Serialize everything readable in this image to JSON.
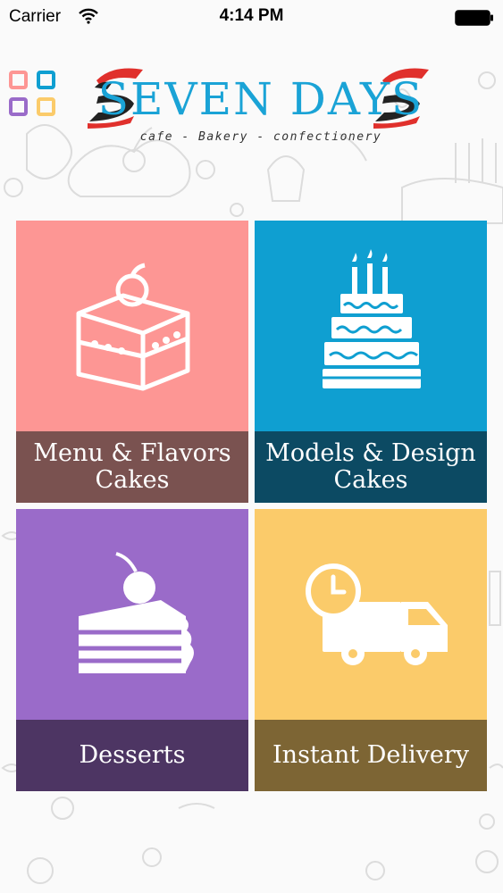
{
  "status_bar": {
    "carrier": "Carrier",
    "time": "4:14 PM"
  },
  "header": {
    "menu_icon": "grid-squares-icon",
    "logo_title": "SEVEN DAYS",
    "logo_tagline": "cafe - Bakery - confectionery"
  },
  "tiles": [
    {
      "label_line1": "Menu & Flavors",
      "label_line2": "Cakes",
      "icon": "cake-slice-with-cherry-icon",
      "color": "#fd9694",
      "label_bg": "#7a5250"
    },
    {
      "label_line1": "Models & Design",
      "label_line2": "Cakes",
      "icon": "tiered-birthday-cake-icon",
      "color": "#0f9fd1",
      "label_bg": "#0c4a63"
    },
    {
      "label_line1": "Desserts",
      "label_line2": "",
      "icon": "layer-cake-slice-icon",
      "color": "#9a6bc9",
      "label_bg": "#4d3563"
    },
    {
      "label_line1": "Instant Delivery",
      "label_line2": "",
      "icon": "delivery-truck-clock-icon",
      "color": "#fbcb6a",
      "label_bg": "#7d6534"
    }
  ]
}
